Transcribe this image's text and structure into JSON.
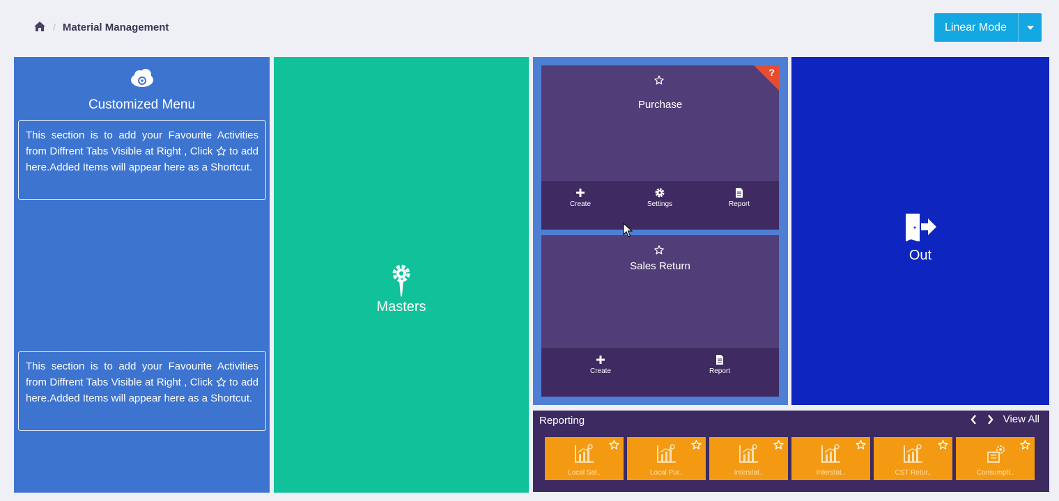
{
  "breadcrumb": {
    "home_icon": "home-icon",
    "separator": "/",
    "current": "Material Management"
  },
  "mode_button": {
    "label": "Linear Mode",
    "color": "#13a8e2"
  },
  "customized_menu": {
    "icon": "cloud-gear-icon",
    "title": "Customized Menu",
    "note_before_star": "This section is to add your Favourite Activities from Diffrent Tabs Visible at Right , Click",
    "note_after_star": "to add here.Added Items will appear here as a Shortcut.",
    "color": "#3d74cf"
  },
  "masters": {
    "label": "Masters",
    "icon": "masters-gear-icon",
    "color": "#11c199"
  },
  "purchase": {
    "title": "Purchase",
    "help": "?",
    "actions": [
      "Create",
      "Settings",
      "Report"
    ]
  },
  "sales_return": {
    "title": "Sales Return",
    "actions": [
      "Create",
      "Report"
    ]
  },
  "out": {
    "label": "Out",
    "icon": "exit-door-icon",
    "color": "#0e25bf"
  },
  "reporting": {
    "title": "Reporting",
    "view_all": "View All",
    "tiles": [
      {
        "label": "Local Sal..",
        "icon": "chart-icon"
      },
      {
        "label": "Local Pur..",
        "icon": "chart-icon"
      },
      {
        "label": "Interstat..",
        "icon": "chart-icon"
      },
      {
        "label": "Interstat..",
        "icon": "chart-icon"
      },
      {
        "label": "CST Retur..",
        "icon": "chart-icon"
      },
      {
        "label": "Consumpti..",
        "icon": "consumption-icon"
      }
    ]
  }
}
